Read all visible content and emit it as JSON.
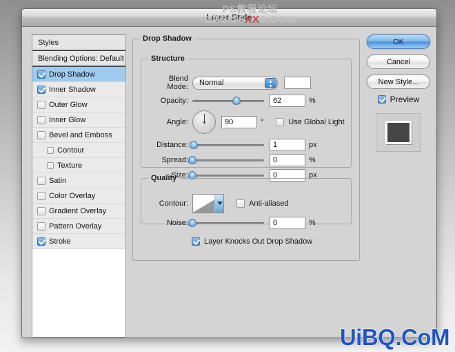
{
  "window": {
    "title": "Layer Style"
  },
  "watermarks": {
    "top_line1": "PS教程论坛",
    "top_line2_pre": "BBS.16",
    "top_line2_red": "XX",
    "top_line2_post": "8.COM",
    "bottom": "UiBQ.CoM"
  },
  "styles_panel": {
    "header": "Styles",
    "blending_options": "Blending Options: Default",
    "items": [
      {
        "label": "Drop Shadow",
        "checked": true,
        "indent": false,
        "selected": true
      },
      {
        "label": "Inner Shadow",
        "checked": true,
        "indent": false,
        "selected": false
      },
      {
        "label": "Outer Glow",
        "checked": false,
        "indent": false,
        "selected": false
      },
      {
        "label": "Inner Glow",
        "checked": false,
        "indent": false,
        "selected": false
      },
      {
        "label": "Bevel and Emboss",
        "checked": false,
        "indent": false,
        "selected": false
      },
      {
        "label": "Contour",
        "checked": false,
        "indent": true,
        "selected": false
      },
      {
        "label": "Texture",
        "checked": false,
        "indent": true,
        "selected": false
      },
      {
        "label": "Satin",
        "checked": false,
        "indent": false,
        "selected": false
      },
      {
        "label": "Color Overlay",
        "checked": false,
        "indent": false,
        "selected": false
      },
      {
        "label": "Gradient Overlay",
        "checked": false,
        "indent": false,
        "selected": false
      },
      {
        "label": "Pattern Overlay",
        "checked": false,
        "indent": false,
        "selected": false
      },
      {
        "label": "Stroke",
        "checked": true,
        "indent": false,
        "selected": false
      }
    ]
  },
  "drop_shadow": {
    "group_label": "Drop Shadow",
    "structure": {
      "label": "Structure",
      "blend_mode": {
        "label": "Blend Mode:",
        "value": "Normal",
        "color_swatch": "#ffffff"
      },
      "opacity": {
        "label": "Opacity:",
        "value": "62",
        "unit": "%",
        "percent": 62
      },
      "angle": {
        "label": "Angle:",
        "value": "90",
        "unit": "°",
        "degrees": 90
      },
      "use_global_light": {
        "label": "Use Global Light",
        "checked": false
      },
      "distance": {
        "label": "Distance:",
        "value": "1",
        "unit": "px",
        "percent": 2
      },
      "spread": {
        "label": "Spread:",
        "value": "0",
        "unit": "%",
        "percent": 0
      },
      "size": {
        "label": "Size:",
        "value": "0",
        "unit": "px",
        "percent": 0
      }
    },
    "quality": {
      "label": "Quality",
      "contour": {
        "label": "Contour:"
      },
      "anti_aliased": {
        "label": "Anti-aliased",
        "checked": false
      },
      "noise": {
        "label": "Noise:",
        "value": "0",
        "unit": "%",
        "percent": 0
      }
    },
    "knockout": {
      "label": "Layer Knocks Out Drop Shadow",
      "checked": true
    }
  },
  "buttons": {
    "ok": "OK",
    "cancel": "Cancel",
    "new_style": "New Style...",
    "preview": {
      "label": "Preview",
      "checked": true
    }
  }
}
